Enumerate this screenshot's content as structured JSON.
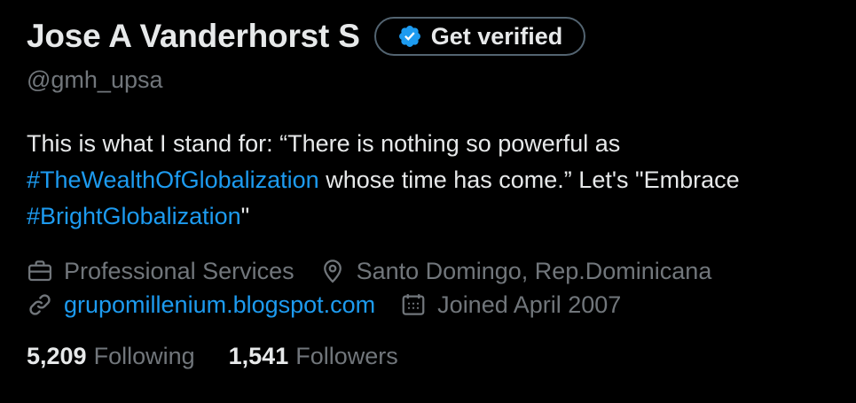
{
  "profile": {
    "display_name": "Jose A Vanderhorst S",
    "handle": "@gmh_upsa",
    "get_verified_label": "Get verified"
  },
  "bio": {
    "part1": "This is what I stand for: “There is nothing so powerful as ",
    "hashtag1": "#TheWealthOfGlobalization",
    "part2": " whose time has come.” Let's \"Embrace ",
    "hashtag2": "#BrightGlobalization",
    "part3": "\""
  },
  "meta": {
    "category": "Professional Services",
    "location": "Santo Domingo, Rep.Dominicana",
    "website": "grupomillenium.blogspot.com",
    "joined": "Joined April 2007"
  },
  "stats": {
    "following_count": "5,209",
    "following_label": "Following",
    "followers_count": "1,541",
    "followers_label": "Followers"
  },
  "colors": {
    "background": "#000000",
    "text_primary": "#e7e9ea",
    "text_secondary": "#71767b",
    "accent": "#1d9bf0",
    "button_border": "#536471"
  },
  "icons": {
    "verified_badge": "verified-badge-icon",
    "category": "briefcase-icon",
    "location": "location-pin-icon",
    "website": "link-icon",
    "joined": "calendar-icon"
  }
}
